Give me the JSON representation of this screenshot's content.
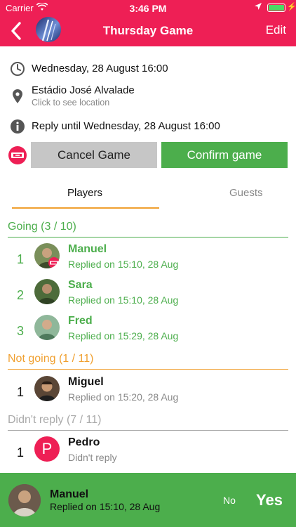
{
  "status_bar": {
    "carrier": "Carrier",
    "time": "3:46 PM"
  },
  "nav": {
    "title": "Thursday Game",
    "edit_label": "Edit"
  },
  "event": {
    "datetime": "Wednesday, 28 August 16:00",
    "venue": "Estádio José Alvalade",
    "venue_hint": "Click to see location",
    "reply_deadline": "Reply until Wednesday, 28 August 16:00"
  },
  "actions": {
    "cancel_label": "Cancel Game",
    "confirm_label": "Confirm game"
  },
  "tabs": [
    {
      "label": "Players",
      "active": true
    },
    {
      "label": "Guests",
      "active": false
    }
  ],
  "sections": {
    "going": {
      "title": "Going (3 / 10)",
      "color": "#4cae4c",
      "players": [
        {
          "rank": "1",
          "name": "Manuel",
          "reply": "Replied on 15:10, 28 Aug"
        },
        {
          "rank": "2",
          "name": "Sara",
          "reply": "Replied on 15:10, 28 Aug"
        },
        {
          "rank": "3",
          "name": "Fred",
          "reply": "Replied on 15:29, 28 Aug"
        }
      ]
    },
    "not_going": {
      "title": "Not going (1 / 11)",
      "color": "#f0a030",
      "players": [
        {
          "rank": "1",
          "name": "Miguel",
          "reply": "Replied on 15:20, 28 Aug"
        }
      ]
    },
    "no_reply": {
      "title": "Didn't reply (7 / 11)",
      "color": "#aaaaaa",
      "players": [
        {
          "rank": "1",
          "name": "Pedro",
          "initial": "P",
          "reply": "Didn't reply"
        }
      ]
    }
  },
  "current_user": {
    "name": "Manuel",
    "reply": "Replied on 15:10, 28 Aug",
    "no_label": "No",
    "yes_label": "Yes"
  },
  "colors": {
    "brand": "#ee1f55",
    "confirm": "#4cae4c",
    "cancel": "#c6c6c6",
    "tab_accent": "#f0a030"
  }
}
